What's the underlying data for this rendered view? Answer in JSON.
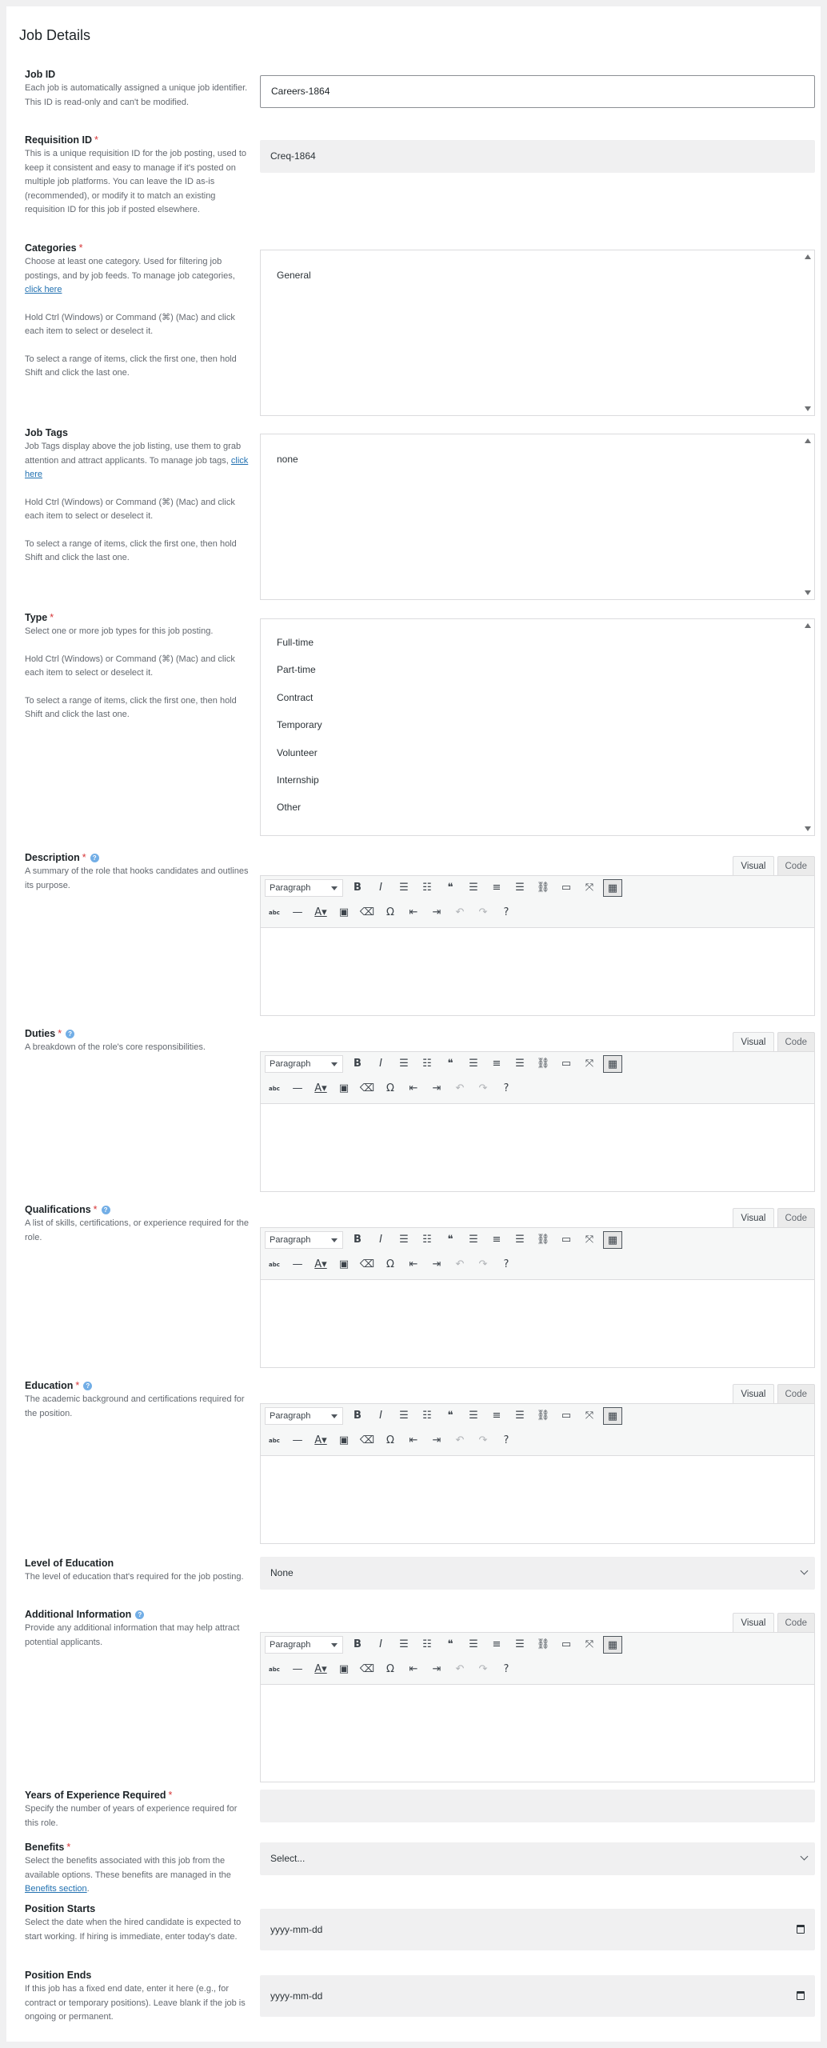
{
  "page_title": "Job Details",
  "required_marker": "*",
  "help_glyph": "?",
  "job_id": {
    "label": "Job ID",
    "desc": "Each job is automatically assigned a unique job identifier. This ID is read-only and can't be modified.",
    "value": "Careers-1864"
  },
  "requisition": {
    "label": "Requisition ID",
    "desc": "This is a unique requisition ID for the job posting, used to keep it consistent and easy to manage if it's posted on multiple job platforms. You can leave the ID as-is (recommended), or modify it to match an existing requisition ID for this job if posted elsewhere.",
    "value": "Creq-1864"
  },
  "multi_help": {
    "ctrl": "Hold Ctrl (Windows) or Command (⌘) (Mac) and click each item to select or deselect it.",
    "shift": "To select a range of items, click the first one, then hold Shift and click the last one."
  },
  "categories": {
    "label": "Categories",
    "desc": "Choose at least one category. Used for filtering job postings, and by job feeds. To manage job categories,",
    "link": "click here",
    "options": [
      "General"
    ]
  },
  "job_tags": {
    "label": "Job Tags",
    "desc": "Job Tags display above the job listing, use them to grab attention and attract applicants. To manage job tags,",
    "link": "click here",
    "options": [
      "none"
    ]
  },
  "type": {
    "label": "Type",
    "desc": "Select one or more job types for this job posting.",
    "options": [
      "Full-time",
      "Part-time",
      "Contract",
      "Temporary",
      "Volunteer",
      "Internship",
      "Other"
    ]
  },
  "editor_common": {
    "visual_tab": "Visual",
    "code_tab": "Code",
    "format": "Paragraph"
  },
  "description": {
    "label": "Description",
    "desc": "A summary of the role that hooks candidates and outlines its purpose."
  },
  "duties": {
    "label": "Duties",
    "desc": "A breakdown of the role's core responsibilities."
  },
  "qualifications": {
    "label": "Qualifications",
    "desc": "A list of skills, certifications, or experience required for the role."
  },
  "education": {
    "label": "Education",
    "desc": "The academic background and certifications required for the position."
  },
  "level_education": {
    "label": "Level of Education",
    "desc": "The level of education that's required for the job posting.",
    "value": "None"
  },
  "additional": {
    "label": "Additional Information",
    "desc": "Provide any additional information that may help attract potential applicants."
  },
  "years_exp": {
    "label": "Years of Experience Required",
    "desc": "Specify the number of years of experience required for this role.",
    "value": ""
  },
  "benefits": {
    "label": "Benefits",
    "desc": "Select the benefits associated with this job from the available options. These benefits are managed in the",
    "link": "Benefits section",
    "desc_end": ".",
    "value": "Select..."
  },
  "position_starts": {
    "label": "Position Starts",
    "desc": "Select the date when the hired candidate is expected to start working. If hiring is immediate, enter today's date.",
    "placeholder": "yyyy-mm-dd"
  },
  "position_ends": {
    "label": "Position Ends",
    "desc": "If this job has a fixed end date, enter it here (e.g., for contract or temporary positions). Leave blank if the job is ongoing or permanent.",
    "placeholder": "yyyy-mm-dd"
  },
  "toolbar_icons": {
    "row1": [
      "bold-icon",
      "italic-icon",
      "bullet-list-icon",
      "numbered-list-icon",
      "blockquote-icon",
      "align-left-icon",
      "align-center-icon",
      "align-right-icon",
      "link-icon",
      "read-more-icon",
      "fullscreen-icon",
      "toolbar-toggle-icon"
    ],
    "row2": [
      "strikethrough-icon",
      "horizontal-line-icon",
      "text-color-icon",
      "paste-text-icon",
      "clear-formatting-icon",
      "special-character-icon",
      "outdent-icon",
      "indent-icon",
      "undo-icon",
      "redo-icon",
      "keyboard-shortcuts-icon"
    ]
  }
}
